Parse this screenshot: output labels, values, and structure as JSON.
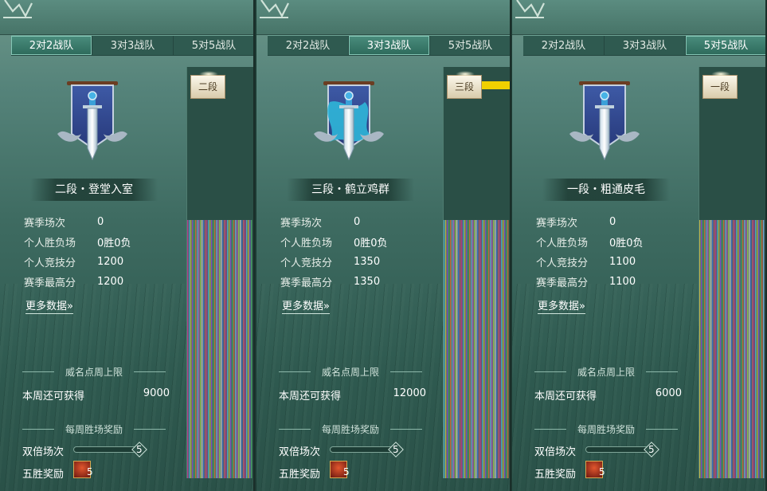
{
  "panels": [
    {
      "tabs": [
        "2对2战队",
        "3对3战队",
        "5对5战队"
      ],
      "active_tab": 0,
      "rank_title": "二段・登堂入室",
      "badge_label": "二段",
      "badge_accent": "#2a4f46",
      "stats": [
        {
          "label": "赛季场次",
          "value": "0"
        },
        {
          "label": "个人胜负场",
          "value": "0胜0负"
        },
        {
          "label": "个人竞技分",
          "value": "1200"
        },
        {
          "label": "赛季最高分",
          "value": "1200"
        }
      ],
      "more_link": "更多数据",
      "weekly_cap_title": "威名点周上限",
      "weekly_remaining_label": "本周还可获得",
      "weekly_remaining_value": "9000",
      "weekly_reward_title": "每周胜场奖励",
      "double_label": "双倍场次",
      "double_value": "5",
      "double_progress": 0,
      "five_win_label": "五胜奖励",
      "five_win_count": "5",
      "emblem": "banner-sword-icon"
    },
    {
      "tabs": [
        "2对2战队",
        "3对3战队",
        "5对5战队"
      ],
      "active_tab": 1,
      "rank_title": "三段・鹤立鸡群",
      "badge_label": "三段",
      "badge_accent": "#f0d000",
      "stats": [
        {
          "label": "赛季场次",
          "value": "0"
        },
        {
          "label": "个人胜负场",
          "value": "0胜0负"
        },
        {
          "label": "个人竞技分",
          "value": "1350"
        },
        {
          "label": "赛季最高分",
          "value": "1350"
        }
      ],
      "more_link": "更多数据",
      "weekly_cap_title": "威名点周上限",
      "weekly_remaining_label": "本周还可获得",
      "weekly_remaining_value": "12000",
      "weekly_reward_title": "每周胜场奖励",
      "double_label": "双倍场次",
      "double_value": "5",
      "double_progress": 0,
      "five_win_label": "五胜奖励",
      "five_win_count": "5",
      "emblem": "banner-dragon-sword-icon"
    },
    {
      "tabs": [
        "2对2战队",
        "3对3战队",
        "5对5战队"
      ],
      "active_tab": 2,
      "rank_title": "一段・粗通皮毛",
      "badge_label": "一段",
      "badge_accent": "#2a4f46",
      "stats": [
        {
          "label": "赛季场次",
          "value": "0"
        },
        {
          "label": "个人胜负场",
          "value": "0胜0负"
        },
        {
          "label": "个人竞技分",
          "value": "1100"
        },
        {
          "label": "赛季最高分",
          "value": "1100"
        }
      ],
      "more_link": "更多数据",
      "weekly_cap_title": "威名点周上限",
      "weekly_remaining_label": "本周还可获得",
      "weekly_remaining_value": "6000",
      "weekly_reward_title": "每周胜场奖励",
      "double_label": "双倍场次",
      "double_value": "5",
      "double_progress": 0,
      "five_win_label": "五胜奖励",
      "five_win_count": "5",
      "emblem": "banner-sword-icon"
    }
  ]
}
